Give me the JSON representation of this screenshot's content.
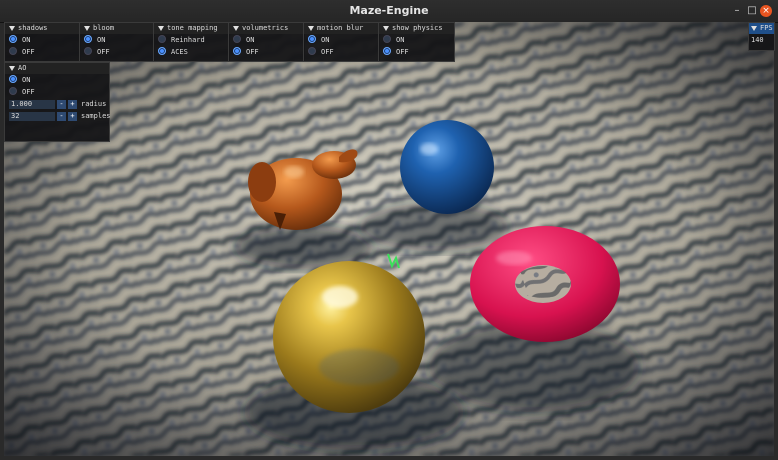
{
  "window": {
    "title": "Maze-Engine",
    "minimize_glyph": "–",
    "maximize_glyph": "□",
    "close_glyph": "×"
  },
  "panels": [
    {
      "title": "shadows",
      "options": [
        "ON",
        "OFF"
      ],
      "selected": 0
    },
    {
      "title": "bloom",
      "options": [
        "ON",
        "OFF"
      ],
      "selected": 0
    },
    {
      "title": "tone mapping",
      "options": [
        "Reinhard",
        "ACES"
      ],
      "selected": 1
    },
    {
      "title": "volumetrics",
      "options": [
        "ON",
        "OFF"
      ],
      "selected": 1
    },
    {
      "title": "motion blur",
      "options": [
        "ON",
        "OFF"
      ],
      "selected": 0
    },
    {
      "title": "show physics",
      "options": [
        "ON",
        "OFF"
      ],
      "selected": 1
    }
  ],
  "ao": {
    "title": "AO",
    "options": [
      "ON",
      "OFF"
    ],
    "selected": 0,
    "radius": {
      "value": "1.000",
      "label": "radius"
    },
    "samples": {
      "value": "32",
      "label": "samples"
    },
    "minus": "-",
    "plus": "+"
  },
  "fps": {
    "title": "FPS",
    "value": "140"
  },
  "scene": {
    "objects": [
      "copper-bunny",
      "blue-sphere",
      "gold-sphere",
      "pink-torus",
      "green-physics-gizmo"
    ],
    "colors": {
      "floor": "#b9b4a4",
      "pattern": "#1f2733",
      "blue_sphere": "#1d5aa0",
      "gold_sphere": "#c9a227",
      "torus": "#e0195a",
      "bunny": "#b5581c"
    }
  }
}
